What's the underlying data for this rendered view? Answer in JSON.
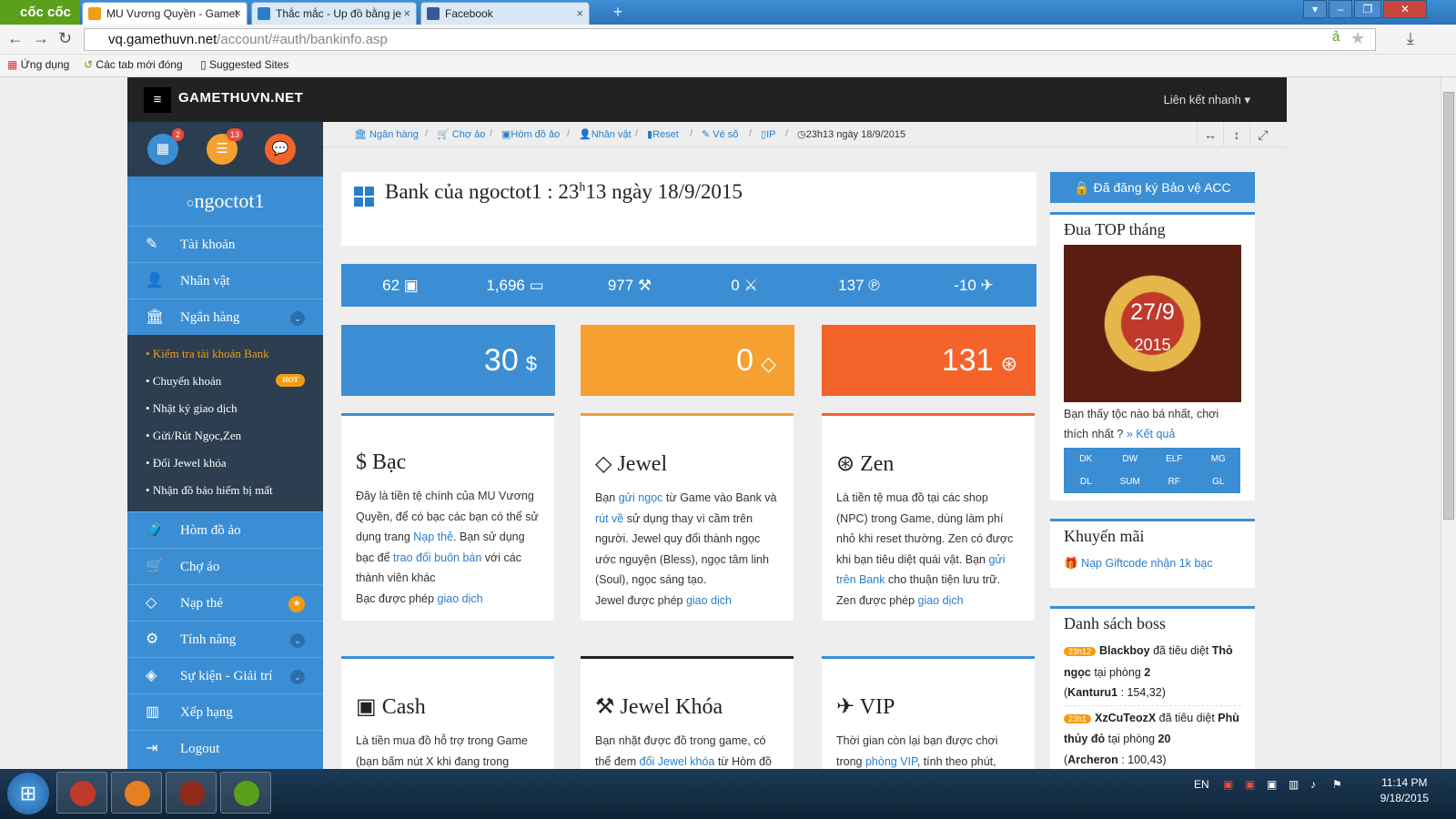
{
  "browser": {
    "logo": "cốc cốc",
    "tabs": [
      {
        "title": "MU Vương Quyền - Gamet",
        "icon": "mu-favicon"
      },
      {
        "title": "Thắc mắc - Up đồ bằng je",
        "icon": "gamethuvn-favicon"
      },
      {
        "title": "Facebook",
        "icon": "facebook-favicon"
      }
    ],
    "url_host": "vq.gamethuvn.net",
    "url_path": "/account/#auth/bankinfo.asp",
    "bookmarks": [
      "Ứng dụng",
      "Các tab mới đóng",
      "Suggested Sites"
    ]
  },
  "site": {
    "brand": "GAMETHUVN.NET",
    "quick_links": "Liên kết nhanh",
    "username": "ngoctot1",
    "circle_badges": [
      "2",
      "13",
      ""
    ],
    "menu": [
      {
        "label": "Tài khoản",
        "icon": "edit-icon"
      },
      {
        "label": "Nhân vật",
        "icon": "user-icon"
      },
      {
        "label": "Ngân hàng",
        "icon": "bank-icon"
      }
    ],
    "submenu": [
      {
        "label": "Kiểm tra tài khoản Bank"
      },
      {
        "label": "Chuyển khoản",
        "badge": "HOT"
      },
      {
        "label": "Nhật ký giao dịch"
      },
      {
        "label": "Gửi/Rút Ngọc,Zen"
      },
      {
        "label": "Đổi Jewel khóa"
      },
      {
        "label": "Nhận đồ bảo hiểm bị mất"
      }
    ],
    "menu2": [
      {
        "label": "Hòm đồ ảo"
      },
      {
        "label": "Chợ ảo"
      },
      {
        "label": "Nạp thẻ"
      },
      {
        "label": "Tính năng"
      },
      {
        "label": "Sự kiện - Giải trí"
      },
      {
        "label": "Xếp hạng"
      },
      {
        "label": "Logout"
      }
    ]
  },
  "breadcrumb": [
    "Ngân hàng",
    "Chợ ảo",
    "Hòm đồ ảo",
    "Nhân vật",
    "Reset",
    "Vé số",
    "IP",
    "23h13 ngày 18/9/2015"
  ],
  "page": {
    "title_a": "Bank của ngoctot1 : 23",
    "title_sup": "h",
    "title_b": "13 ngày 18/9/2015"
  },
  "stats": [
    "62",
    "1,696",
    "977",
    "0",
    "137",
    "-10"
  ],
  "bigbox": [
    {
      "value": "30",
      "unit": "$",
      "color": "#3c8ed4"
    },
    {
      "value": "0",
      "unit": "◇",
      "color": "#f5a031"
    },
    {
      "value": "131",
      "unit": "⊛",
      "color": "#f4632a"
    }
  ],
  "cards": {
    "bac": {
      "title": "Bạc",
      "t1": "Đây là tiền tệ chính của MU Vương Quyền, để có bạc các bạn có thể sử dụng trang ",
      "l1": "Nạp thẻ",
      "t2": ". Bạn sử dụng bạc để ",
      "l2": "trao đổi buôn bán",
      "t3": " với các thành viên khác",
      "t4": "Bạc được phép ",
      "l3": "giao dịch"
    },
    "jewel": {
      "title": "Jewel",
      "t1": "Bạn ",
      "l1": "gửi ngọc",
      "t2": " từ Game vào Bank và ",
      "l2": "rút về",
      "t3": " sử dụng thay vì cầm trên người. Jewel quy đổi thành ngọc ước nguyện (Bless), ngọc tâm linh (Soul), ngọc sáng tạo.",
      "t4": "Jewel được phép ",
      "l3": "giao dịch"
    },
    "zen": {
      "title": "Zen",
      "t1": "Là tiền tệ mua đồ tại các shop (NPC) trong Game, dùng làm phí nhỏ khi reset thường. Zen có được khi bạn tiêu diệt quái vật. Bạn ",
      "l1": "gửi trên Bank",
      "t2": " cho thuận tiện lưu trữ.",
      "t4": "Zen được phép ",
      "l3": "giao dịch"
    },
    "cash": {
      "title": "Cash",
      "t1": "Là tiền mua đồ hỗ trợ trong Game (bạn bấm nút X khi đang trong"
    },
    "jewelkhoa": {
      "title": "Jewel Khóa",
      "t1": "Bạn nhặt được đồ trong game, có thể đem ",
      "l1": "đổi Jewel khóa",
      "t2": " từ Hòm đồ"
    },
    "vip": {
      "title": "VIP",
      "t1": "Thời gian còn lại bạn được chơi trong ",
      "l1": "phòng VIP",
      "t2": ", tính theo phút,"
    }
  },
  "right": {
    "protect_btn": "Đã đăng ký Bảo vệ ACC",
    "top_title": "Đua TOP tháng",
    "top_date": "27/9",
    "top_year": "2015",
    "top_question": "Bạn thấy tộc nào bá nhất, chơi thích nhất ? ",
    "top_result": "» Kết quả",
    "classes": [
      "DK",
      "DW",
      "ELF",
      "MG",
      "DL",
      "SUM",
      "RF",
      "GL"
    ],
    "promo_title": "Khuyến mãi",
    "promo_link": "Nạp Giftcode nhận 1k bạc",
    "boss_title": "Danh sách boss",
    "bosses": [
      {
        "time": "23h12",
        "player": "Blackboy",
        "verb": " đã tiêu diệt ",
        "boss": "Thỏ ngọc",
        "room_pre": " tại phòng ",
        "room": "2",
        "map": "Kanturu1",
        "coord": " : 154,32)"
      },
      {
        "time": "23h1",
        "player": "XzCuTeozX",
        "verb": " đã tiêu diệt ",
        "boss": "Phù thủy đỏ",
        "room_pre": " tại phòng ",
        "room": "20",
        "map": "Archeron",
        "coord": " : 100,43)"
      }
    ]
  },
  "taskbar": {
    "lang": "EN",
    "time": "11:14 PM",
    "date": "9/18/2015"
  }
}
